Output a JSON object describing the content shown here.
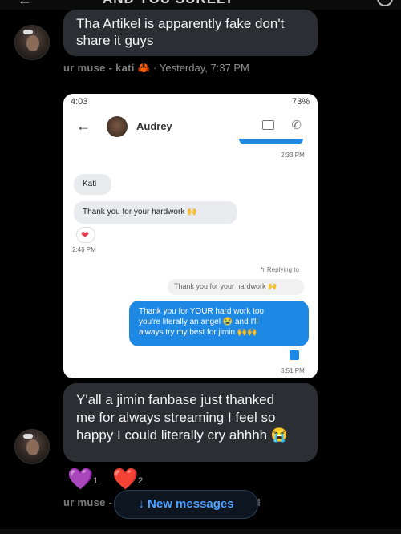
{
  "top_bar": {
    "title": "AND YOU SURELY"
  },
  "message1": {
    "text_line1": "Tha Artikel is apparently fake don't",
    "text_line2": "share it guys"
  },
  "meta1": {
    "name": "ur muse - kati",
    "emoji": "🦀",
    "time": "· Yesterday, 7:37 PM"
  },
  "phone": {
    "status_time": "4:03",
    "status_right": "73%",
    "contact_name": "Audrey",
    "ts1": "2:33 PM",
    "msg_kati": "Kati",
    "msg_thanks": "Thank you for your hardwork 🙌",
    "ts2": "2:46 PM",
    "replying": "↰ Replying to",
    "quoted": "Thank you for your hardwork 🙌",
    "reply_line1": "Thank you for YOUR hard work too",
    "reply_line2": "you're literally an angel 😭 and I'll",
    "reply_line3": "always try my best for jimin 🙌🙌",
    "ts3": "3:51 PM"
  },
  "message2": {
    "line1": "Y'all a jimin fanbase just thanked",
    "line2": "me for always streaming I feel so",
    "line3": "happy I could literally cry ahhhh 😭"
  },
  "reactions": [
    {
      "emoji": "💜",
      "count": "1"
    },
    {
      "emoji": "❤️",
      "count": "2"
    }
  ],
  "meta2": {
    "name": "ur muse -",
    "suffix": "4"
  },
  "new_messages": {
    "label": "↓ New messages"
  },
  "colors": {
    "accent": "#1e88e5",
    "bubble_dark": "#2b2f33",
    "new_msg_text": "#4ea3ff"
  }
}
